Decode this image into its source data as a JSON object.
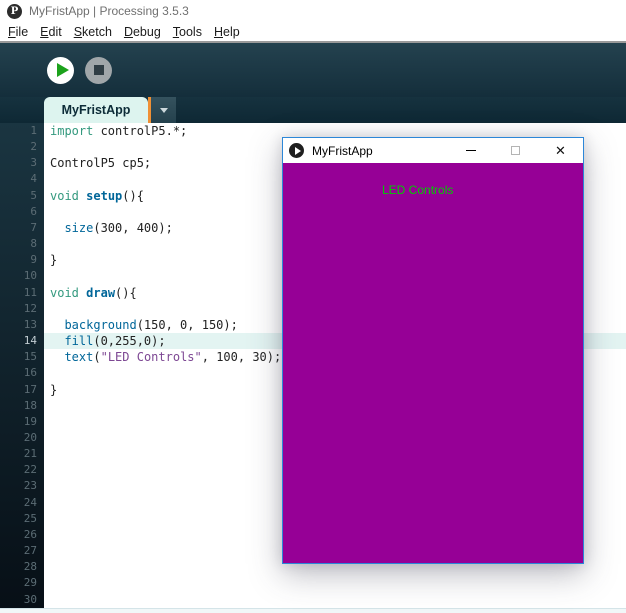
{
  "window": {
    "title": "MyFristApp | Processing 3.5.3",
    "app_icon": "processing-logo-icon",
    "app_icon_glyph": "P"
  },
  "menubar": {
    "items": [
      {
        "label": "File"
      },
      {
        "label": "Edit"
      },
      {
        "label": "Sketch"
      },
      {
        "label": "Debug"
      },
      {
        "label": "Tools"
      },
      {
        "label": "Help"
      }
    ]
  },
  "toolbar": {
    "run_icon": "run-play-icon",
    "stop_icon": "stop-icon"
  },
  "tabbar": {
    "active_tab": "MyFristApp",
    "dropdown_icon": "chevron-down-icon",
    "accent_color": "#f09035"
  },
  "editor": {
    "total_lines": 30,
    "highlighted_line": 14,
    "highlight_color": "#e3f4f2",
    "syntax_colors": {
      "keyword": "#33997e",
      "function": "#006699",
      "string": "#7d4793",
      "plain": "#222222"
    },
    "lines": [
      {
        "n": 1,
        "s": [
          [
            "k",
            "import"
          ],
          [
            "p",
            " controlP5.*;"
          ]
        ]
      },
      {
        "n": 2,
        "s": []
      },
      {
        "n": 3,
        "s": [
          [
            "p",
            "ControlP5 cp5;"
          ]
        ]
      },
      {
        "n": 4,
        "s": []
      },
      {
        "n": 5,
        "s": [
          [
            "k",
            "void"
          ],
          [
            "p",
            " "
          ],
          [
            "b",
            "setup"
          ],
          [
            "p",
            "(){"
          ]
        ]
      },
      {
        "n": 6,
        "s": []
      },
      {
        "n": 7,
        "s": [
          [
            "p",
            "  "
          ],
          [
            "f",
            "size"
          ],
          [
            "p",
            "(300, 400);"
          ]
        ]
      },
      {
        "n": 8,
        "s": []
      },
      {
        "n": 9,
        "s": [
          [
            "p",
            "}"
          ]
        ]
      },
      {
        "n": 10,
        "s": []
      },
      {
        "n": 11,
        "s": [
          [
            "k",
            "void"
          ],
          [
            "p",
            " "
          ],
          [
            "b",
            "draw"
          ],
          [
            "p",
            "(){"
          ]
        ]
      },
      {
        "n": 12,
        "s": []
      },
      {
        "n": 13,
        "s": [
          [
            "p",
            "  "
          ],
          [
            "f",
            "background"
          ],
          [
            "p",
            "(150, 0, 150);"
          ]
        ]
      },
      {
        "n": 14,
        "s": [
          [
            "p",
            "  "
          ],
          [
            "f",
            "fill"
          ],
          [
            "p",
            "(0,255,0);"
          ]
        ]
      },
      {
        "n": 15,
        "s": [
          [
            "p",
            "  "
          ],
          [
            "f",
            "text"
          ],
          [
            "p",
            "("
          ],
          [
            "q",
            "\"LED Controls\""
          ],
          [
            "p",
            ", 100, 30);"
          ]
        ]
      },
      {
        "n": 16,
        "s": []
      },
      {
        "n": 17,
        "s": [
          [
            "p",
            "}"
          ]
        ]
      },
      {
        "n": 18,
        "s": []
      },
      {
        "n": 19,
        "s": []
      },
      {
        "n": 20,
        "s": []
      },
      {
        "n": 21,
        "s": []
      },
      {
        "n": 22,
        "s": []
      },
      {
        "n": 23,
        "s": []
      },
      {
        "n": 24,
        "s": []
      },
      {
        "n": 25,
        "s": []
      },
      {
        "n": 26,
        "s": []
      },
      {
        "n": 27,
        "s": []
      },
      {
        "n": 28,
        "s": []
      },
      {
        "n": 29,
        "s": []
      },
      {
        "n": 30,
        "s": []
      }
    ]
  },
  "sketch_window": {
    "title": "MyFristApp",
    "icon": "play-icon",
    "minimize_icon": "minimize-icon",
    "maximize_icon": "maximize-icon",
    "close_icon": "close-icon",
    "close_glyph": "✕",
    "canvas_text": "LED Controls",
    "canvas_color": "#960096",
    "canvas_text_color": "#00cc00"
  }
}
